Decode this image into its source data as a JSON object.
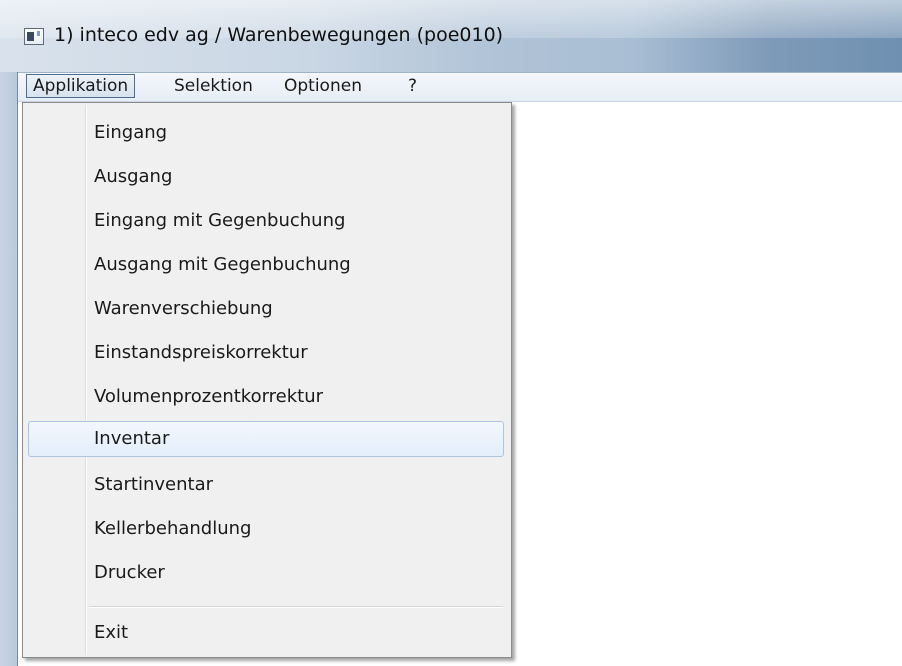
{
  "window": {
    "title": "1) inteco edv ag / Warenbewegungen (poe010)",
    "icon": "application-window-icon"
  },
  "menubar": {
    "items": [
      {
        "label": "Applikation",
        "active": true
      },
      {
        "label": "Selektion"
      },
      {
        "label": "Optionen"
      },
      {
        "label": "?"
      }
    ]
  },
  "dropdown": {
    "items": [
      {
        "label": "Eingang"
      },
      {
        "label": "Ausgang"
      },
      {
        "label": "Eingang mit Gegenbuchung"
      },
      {
        "label": "Ausgang mit Gegenbuchung"
      },
      {
        "label": "Warenverschiebung"
      },
      {
        "label": "Einstandspreiskorrektur"
      },
      {
        "label": "Volumenprozentkorrektur"
      },
      {
        "label": "Inventar",
        "highlighted": true
      },
      {
        "label": "Startinventar"
      },
      {
        "label": "Kellerbehandlung"
      },
      {
        "label": "Drucker"
      },
      {
        "label": "Exit"
      }
    ]
  },
  "colors": {
    "highlight_border": "#a9c6e6",
    "menu_background": "#f0f0f0"
  }
}
